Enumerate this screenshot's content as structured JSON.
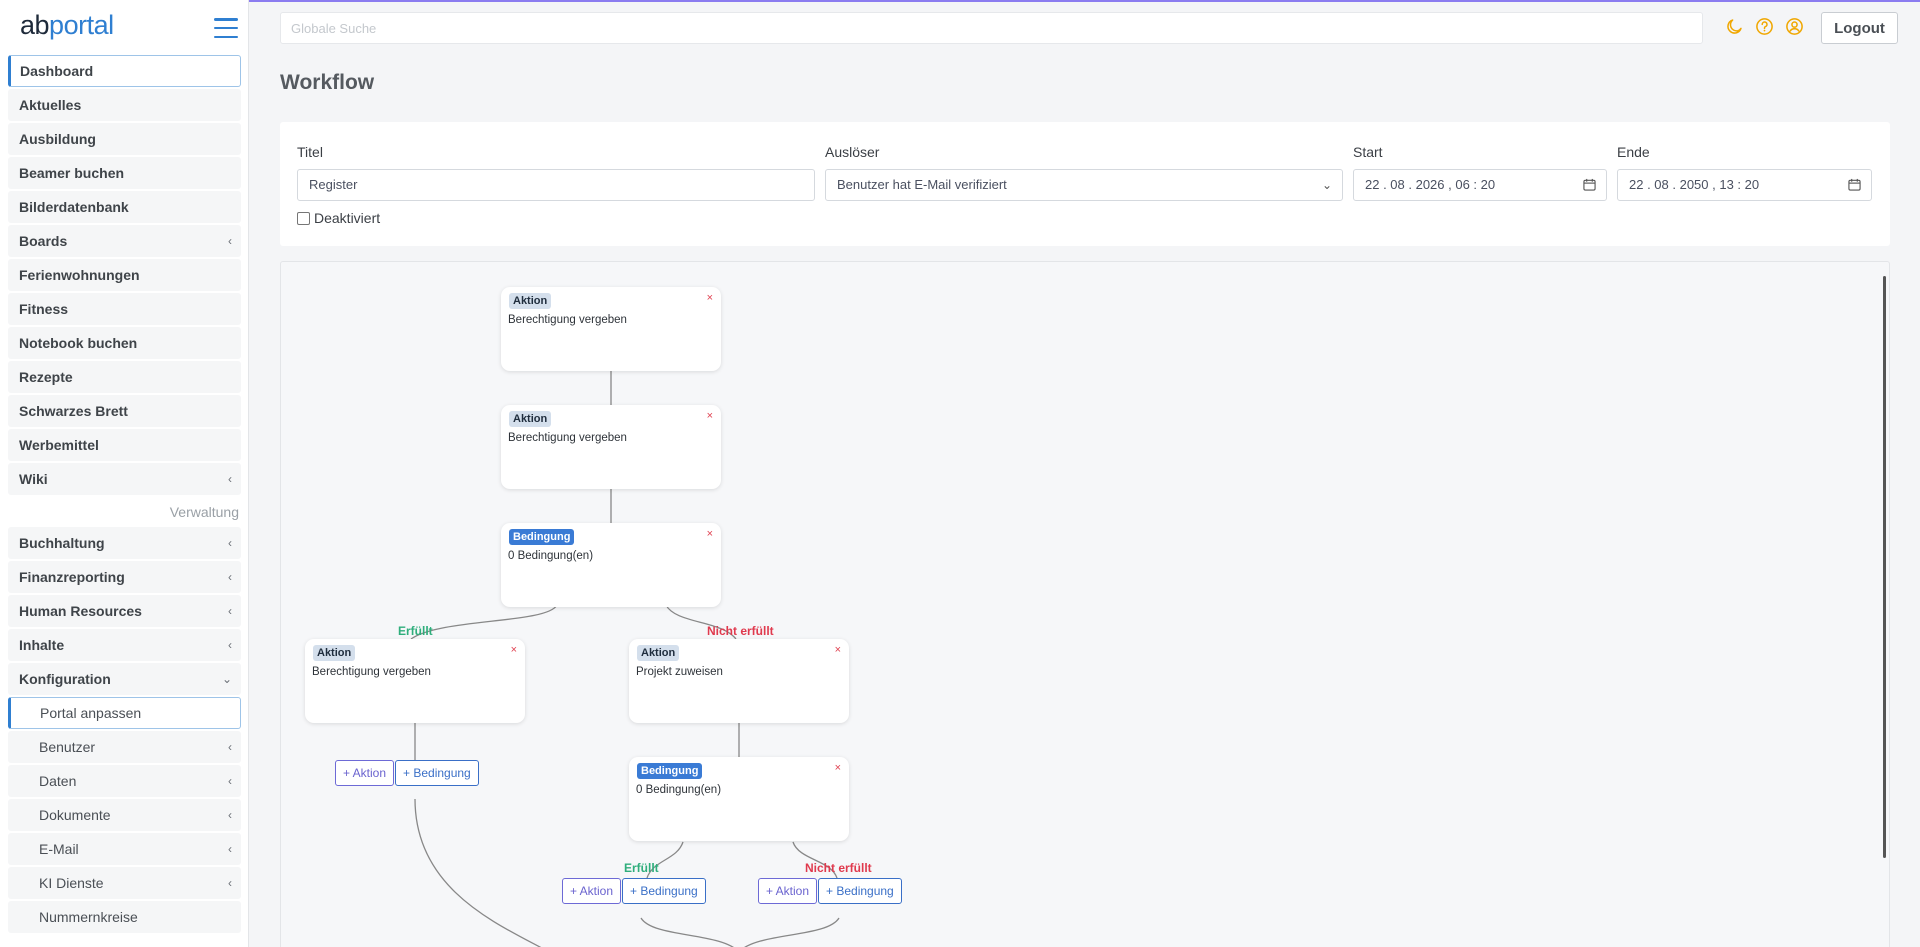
{
  "brand": {
    "part1": "ab",
    "part2": "portal"
  },
  "search": {
    "placeholder": "Globale Suche"
  },
  "header": {
    "logout_label": "Logout",
    "icons": [
      "moon-icon",
      "help-icon",
      "user-icon"
    ]
  },
  "sidebar": {
    "items": [
      {
        "label": "Dashboard",
        "active": true,
        "chevron": ""
      },
      {
        "label": "Aktuelles",
        "chevron": ""
      },
      {
        "label": "Ausbildung",
        "chevron": ""
      },
      {
        "label": "Beamer buchen",
        "chevron": ""
      },
      {
        "label": "Bilderdatenbank",
        "chevron": ""
      },
      {
        "label": "Boards",
        "chevron": "‹"
      },
      {
        "label": "Ferienwohnungen",
        "chevron": ""
      },
      {
        "label": "Fitness",
        "chevron": ""
      },
      {
        "label": "Notebook buchen",
        "chevron": ""
      },
      {
        "label": "Rezepte",
        "chevron": ""
      },
      {
        "label": "Schwarzes Brett",
        "chevron": ""
      },
      {
        "label": "Werbemittel",
        "chevron": ""
      },
      {
        "label": "Wiki",
        "chevron": "‹"
      }
    ],
    "section_label": "Verwaltung",
    "admin_items": [
      {
        "label": "Buchhaltung",
        "chevron": "‹"
      },
      {
        "label": "Finanzreporting",
        "chevron": "‹"
      },
      {
        "label": "Human Resources",
        "chevron": "‹"
      },
      {
        "label": "Inhalte",
        "chevron": "‹"
      },
      {
        "label": "Konfiguration",
        "chevron": "⌄"
      }
    ],
    "sub_items": [
      {
        "label": "Portal anpassen",
        "active": true,
        "chevron": ""
      },
      {
        "label": "Benutzer",
        "chevron": "‹"
      },
      {
        "label": "Daten",
        "chevron": "‹"
      },
      {
        "label": "Dokumente",
        "chevron": "‹"
      },
      {
        "label": "E-Mail",
        "chevron": "‹"
      },
      {
        "label": "KI Dienste",
        "chevron": "‹"
      },
      {
        "label": "Nummernkreise",
        "chevron": ""
      }
    ]
  },
  "page": {
    "title": "Workflow"
  },
  "form": {
    "titel_label": "Titel",
    "titel_value": "Register",
    "ausloeser_label": "Auslöser",
    "ausloeser_value": "Benutzer hat E-Mail verifiziert",
    "start_label": "Start",
    "start_value": "22 . 08 . 2026 ,  06 : 20",
    "ende_label": "Ende",
    "ende_value": "22 . 08 . 2050 ,  13 : 20",
    "deaktiviert_label": "Deaktiviert",
    "deaktiviert_checked": false
  },
  "workflow": {
    "nodes": [
      {
        "type": "Aktion",
        "desc": "Berechtigung vergeben",
        "close": "×"
      },
      {
        "type": "Aktion",
        "desc": "Berechtigung vergeben",
        "close": "×"
      },
      {
        "type": "Bedingung",
        "desc": "0 Bedingung(en)",
        "close": "×"
      },
      {
        "type": "Aktion",
        "desc": "Berechtigung vergeben",
        "close": "×"
      },
      {
        "type": "Aktion",
        "desc": "Projekt zuweisen",
        "close": "×"
      },
      {
        "type": "Bedingung",
        "desc": "0 Bedingung(en)",
        "close": "×"
      }
    ],
    "branch_labels": {
      "ok": "Erfüllt",
      "no": "Nicht erfüllt"
    },
    "add_aktion": "+ Aktion",
    "add_bedingung": "+ Bedingung"
  }
}
